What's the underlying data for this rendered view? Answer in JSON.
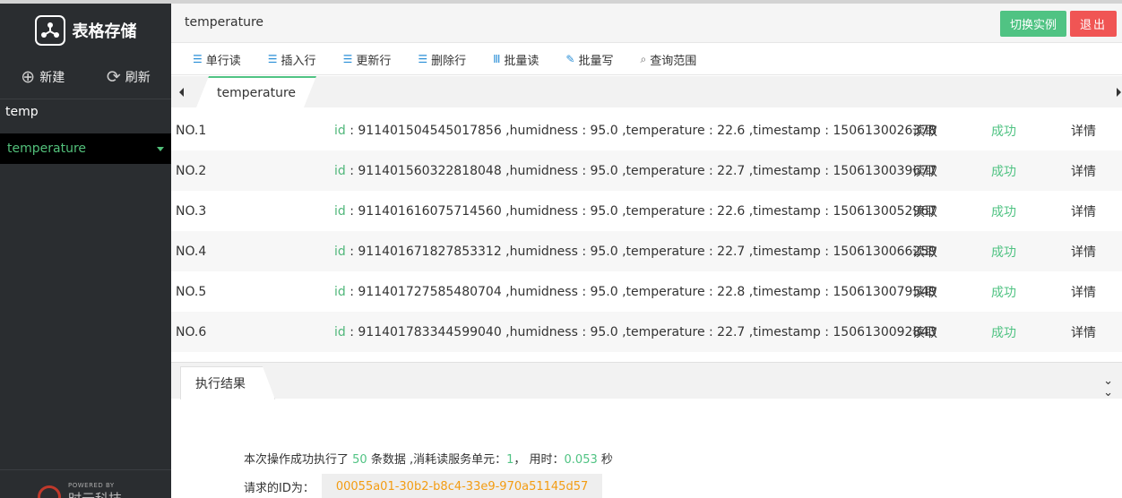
{
  "app": {
    "brand_title": "表格存储",
    "new_label": "新建",
    "refresh_label": "刷新",
    "instance_name": "temp",
    "table_name": "temperature",
    "powered_small": "POWERED BY",
    "powered_name": "时云科技"
  },
  "header": {
    "title": "temperature",
    "switch_label": "切换实例",
    "exit_label": "退出"
  },
  "toolbar": {
    "items": [
      {
        "label": "单行读",
        "icon": "list-icon"
      },
      {
        "label": "插入行",
        "icon": "insert-row-icon"
      },
      {
        "label": "更新行",
        "icon": "update-row-icon"
      },
      {
        "label": "删除行",
        "icon": "delete-row-icon"
      },
      {
        "label": "批量读",
        "icon": "batch-read-icon"
      },
      {
        "label": "批量写",
        "icon": "batch-write-icon"
      },
      {
        "label": "查询范围",
        "icon": "search-icon"
      }
    ]
  },
  "tabs": {
    "active": "temperature"
  },
  "rows": [
    {
      "no": "NO.1",
      "key": "id",
      "rest": " : 911401504545017856 ,humidness : 95.0 ,temperature : 22.6 ,timestamp : 1506130026378",
      "op": "读取",
      "status": "成功",
      "detail": "详情"
    },
    {
      "no": "NO.2",
      "key": "id",
      "rest": " : 911401560322818048 ,humidness : 95.0 ,temperature : 22.7 ,timestamp : 1506130039677",
      "op": "读取",
      "status": "成功",
      "detail": "详情"
    },
    {
      "no": "NO.3",
      "key": "id",
      "rest": " : 911401616075714560 ,humidness : 95.0 ,temperature : 22.6 ,timestamp : 1506130052967",
      "op": "读取",
      "status": "成功",
      "detail": "详情"
    },
    {
      "no": "NO.4",
      "key": "id",
      "rest": " : 911401671827853312 ,humidness : 95.0 ,temperature : 22.7 ,timestamp : 1506130066259",
      "op": "读取",
      "status": "成功",
      "detail": "详情"
    },
    {
      "no": "NO.5",
      "key": "id",
      "rest": " : 911401727585480704 ,humidness : 95.0 ,temperature : 22.8 ,timestamp : 1506130079549",
      "op": "读取",
      "status": "成功",
      "detail": "详情"
    },
    {
      "no": "NO.6",
      "key": "id",
      "rest": " : 911401783344599040 ,humidness : 95.0 ,temperature : 22.7 ,timestamp : 1506130092843",
      "op": "读取",
      "status": "成功",
      "detail": "详情"
    }
  ],
  "result": {
    "tab_label": "执行结果",
    "s1": "本次操作成功执行了 ",
    "count": "50",
    "s2": " 条数据 ,消耗读服务单元：",
    "units": "1",
    "s3": "， 用时：",
    "time": "0.053",
    "s4": " 秒",
    "reqid_label": "请求的ID为：",
    "reqid": "00055a01-30b2-b8c4-33e9-970a51145d57"
  },
  "colors": {
    "sidebar_bg": "#2a2d30",
    "accent_green": "#50c383",
    "danger_red": "#f05554",
    "reqid_orange": "#f39c12"
  }
}
